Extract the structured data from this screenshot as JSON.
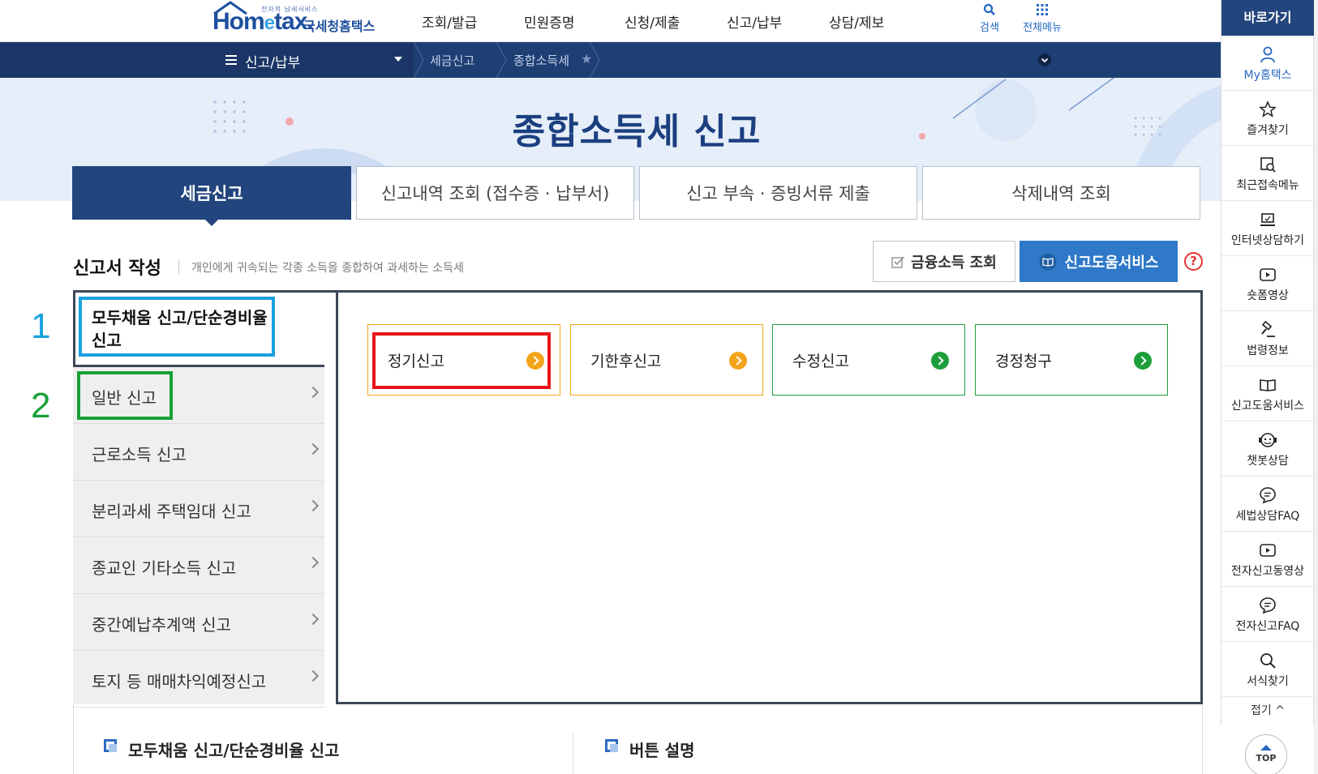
{
  "header": {
    "logo_small": "전자적 납세서비스",
    "logo_main_pre": "Hom",
    "logo_main_e": "e",
    "logo_main_post": "tax.",
    "logo_sub": "국세청홈택스",
    "nav": [
      "조회/발급",
      "민원증명",
      "신청/제출",
      "신고/납부",
      "상담/제보"
    ],
    "search_label": "검색",
    "allmenu_label": "전체메뉴"
  },
  "breadcrumb": {
    "menu_title": "신고/납부",
    "items": [
      "세금신고",
      "종합소득세"
    ]
  },
  "hero": {
    "title": "종합소득세 신고"
  },
  "tabs": [
    {
      "label": "세금신고",
      "active": true
    },
    {
      "label": "신고내역 조회 (접수증 · 납부서)",
      "active": false
    },
    {
      "label": "신고 부속 · 증빙서류 제출",
      "active": false
    },
    {
      "label": "삭제내역 조회",
      "active": false
    }
  ],
  "section": {
    "title": "신고서 작성",
    "description": "개인에게 귀속되는 각종 소득을 종합하여 과세하는 소득세",
    "btn_financial": "금융소득 조회",
    "btn_help": "신고도움서비스",
    "help_q": "?"
  },
  "left_menu": {
    "head": "모두채움 신고/단순경비율 신고",
    "items": [
      "일반 신고",
      "근로소득 신고",
      "분리과세 주택임대 신고",
      "종교인 기타소득 신고",
      "중간예납추계액 신고",
      "토지 등 매매차익예정신고"
    ]
  },
  "cards": [
    {
      "label": "정기신고",
      "color": "#f3a51a"
    },
    {
      "label": "기한후신고",
      "color": "#f3a51a"
    },
    {
      "label": "수정신고",
      "color": "#1e9e3a"
    },
    {
      "label": "경정청구",
      "color": "#1e9e3a"
    }
  ],
  "annotations": {
    "num1": "1",
    "num2": "2",
    "num1_color": "#1aa0e0",
    "num2_color": "#1aa03a",
    "red": "#e8151b"
  },
  "bottom": {
    "left_heading": "모두채움 신고/단순경비율 신고",
    "right_heading": "버튼 설명"
  },
  "quick_menu": {
    "title": "바로가기",
    "items": [
      {
        "label": "My홈택스",
        "icon": "person-icon"
      },
      {
        "label": "즐겨찾기",
        "icon": "star-icon"
      },
      {
        "label": "최근접속메뉴",
        "icon": "recent-menu-icon"
      },
      {
        "label": "인터넷상담하기",
        "icon": "laptop-icon"
      },
      {
        "label": "숏폼영상",
        "icon": "play-icon"
      },
      {
        "label": "법령정보",
        "icon": "gavel-icon"
      },
      {
        "label": "신고도움서비스",
        "icon": "book-icon"
      },
      {
        "label": "챗봇상담",
        "icon": "chatbot-icon"
      },
      {
        "label": "세법상담FAQ",
        "icon": "chat-bubble-icon"
      },
      {
        "label": "전자신고동영상",
        "icon": "video-icon"
      },
      {
        "label": "전자신고FAQ",
        "icon": "chat-bubble-icon"
      },
      {
        "label": "서식찾기",
        "icon": "magnifier-icon"
      }
    ],
    "fold": "접기 ^",
    "top": "TOP"
  }
}
